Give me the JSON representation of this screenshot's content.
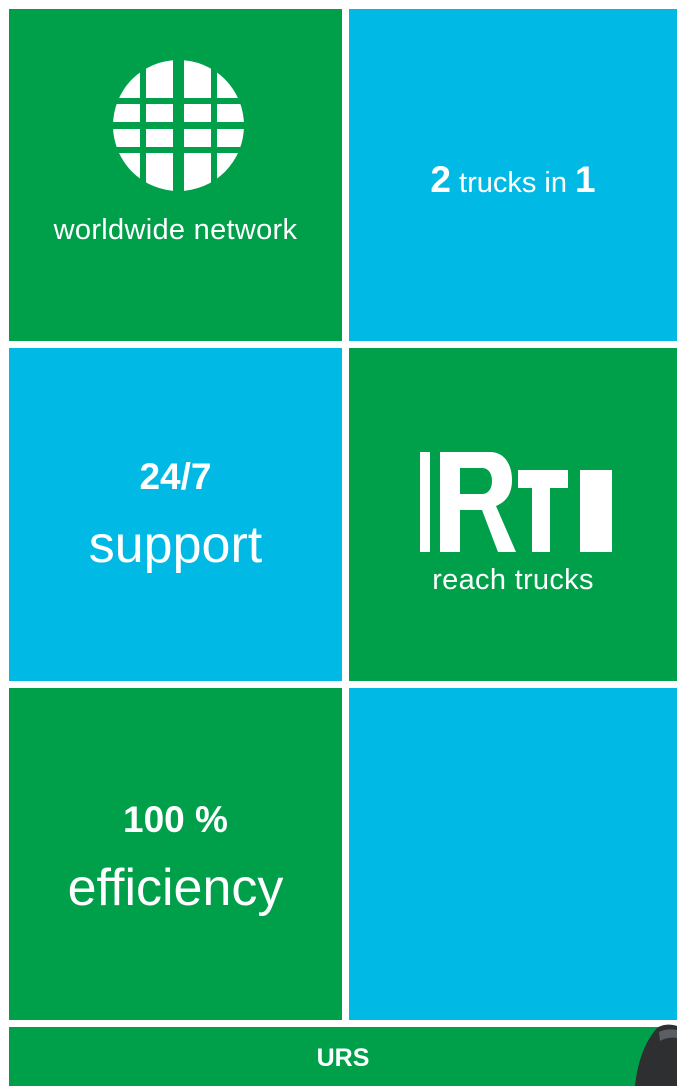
{
  "tiles": {
    "worldwide": {
      "label": "worldwide network"
    },
    "trucks": {
      "num_a": "2",
      "middle": " trucks in ",
      "num_b": "1"
    },
    "support": {
      "number": "24/7",
      "word": "support"
    },
    "reach": {
      "label": "reach trucks"
    },
    "efficiency": {
      "number": "100 %",
      "word": "efficiency"
    }
  },
  "footer": {
    "label": "URS"
  },
  "icons": {
    "globe": "globe-icon",
    "rt_logo": "rt-logo-icon"
  },
  "colors": {
    "green": "#00a04a",
    "blue": "#00b9e4",
    "text": "#ffffff",
    "background": "#ffffff"
  }
}
